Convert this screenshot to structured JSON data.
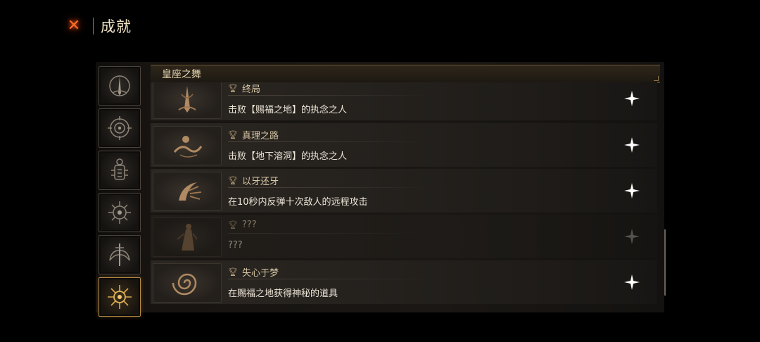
{
  "header": {
    "title": "成就",
    "close_icon": "close-x-icon"
  },
  "sidebar": {
    "tabs": [
      {
        "icon": "spire-emblem-icon",
        "active": false
      },
      {
        "icon": "ring-sigil-icon",
        "active": false
      },
      {
        "icon": "urn-totem-icon",
        "active": false
      },
      {
        "icon": "spiked-eye-icon",
        "active": false
      },
      {
        "icon": "winged-sword-icon",
        "active": false
      },
      {
        "icon": "radiant-crest-icon",
        "active": true
      }
    ]
  },
  "category": {
    "title": "皇座之舞"
  },
  "achievements": [
    {
      "title": "终局",
      "description": "击败【赐福之地】的执念之人",
      "icon": "spire-icon",
      "locked": false
    },
    {
      "title": "真理之路",
      "description": "击败【地下溶洞】的执念之人",
      "icon": "serpent-icon",
      "locked": false
    },
    {
      "title": "以牙还牙",
      "description": "在10秒内反弹十次敌人的远程攻击",
      "icon": "crescent-burst-icon",
      "locked": false
    },
    {
      "title": "???",
      "description": "???",
      "icon": "robed-figure-icon",
      "locked": true
    },
    {
      "title": "失心于梦",
      "description": "在赐福之地获得神秘的道具",
      "icon": "spiral-swirl-icon",
      "locked": false
    }
  ],
  "colors": {
    "accent_gold": "#b48a46",
    "close_orange": "#ff6a2a",
    "background": "#000000"
  }
}
